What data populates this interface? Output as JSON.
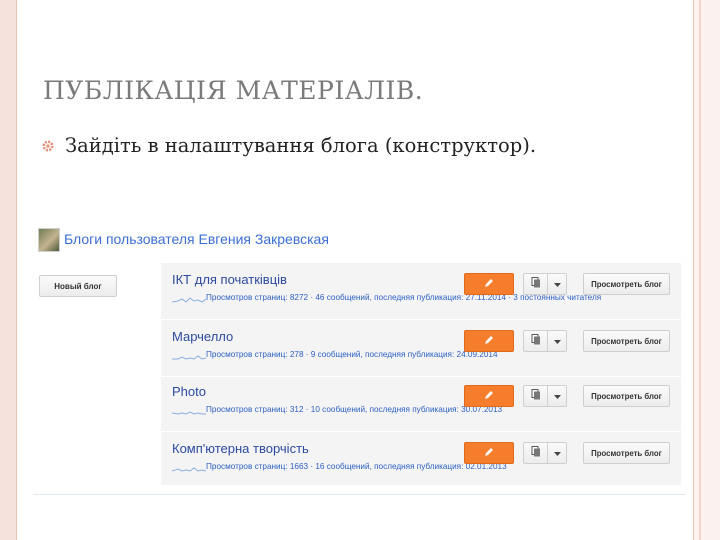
{
  "slide": {
    "title": "ПУБЛІКАЦІЯ МАТЕРІАЛІВ.",
    "bullet": "Зайдіть в налаштування блога (конструктор)."
  },
  "screenshot": {
    "header": "Блоги пользователя Евгения Закревская",
    "new_blog_label": "Новый блог",
    "view_blog_label": "Просмотреть блог",
    "blogs": [
      {
        "title": "ІКТ для початківців",
        "stats": "Просмотров страниц: 8272 · 46 сообщений, последняя публикация: 27.11.2014 · 3 постоянных читателя"
      },
      {
        "title": "Марчелло",
        "stats": "Просмотров страниц: 278 · 9 сообщений, последняя публикация: 24.09.2014"
      },
      {
        "title": "Photo",
        "stats": "Просмотров страниц: 312 · 10 сообщений, последняя публикация: 30.07.2013"
      },
      {
        "title": "Комп'ютерна творчість",
        "stats": "Просмотров страниц: 1663 · 16 сообщений, последняя публикация: 02.01.2013"
      }
    ]
  },
  "colors": {
    "accent_orange": "#f57d2c",
    "link_blue": "#3b6fd6",
    "slide_accent": "#e58d75"
  },
  "icons": [
    "bullet-gear-icon",
    "avatar",
    "pencil-icon",
    "document-copy-icon",
    "chevron-down-icon",
    "sparkline"
  ]
}
